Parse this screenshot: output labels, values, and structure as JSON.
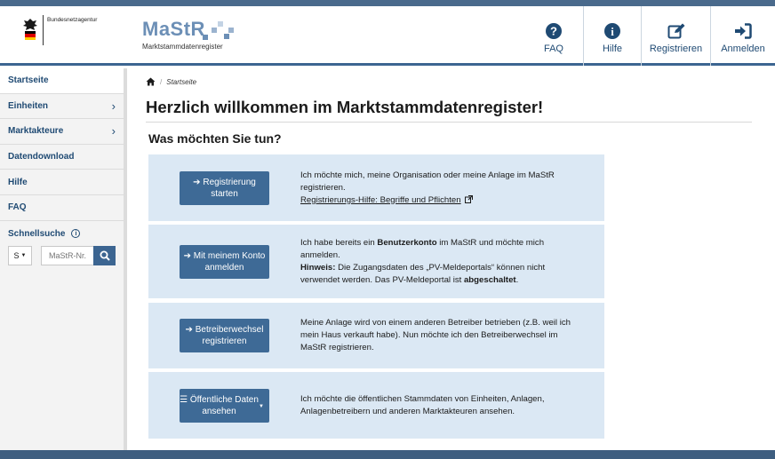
{
  "header": {
    "agency": "Bundesnetzagentur",
    "logo_word": "MaStR",
    "logo_sub": "Marktstammdatenregister",
    "nav": [
      {
        "label": "FAQ",
        "icon": "question-circle-icon"
      },
      {
        "label": "Hilfe",
        "icon": "info-circle-icon"
      },
      {
        "label": "Registrieren",
        "icon": "edit-icon"
      },
      {
        "label": "Anmelden",
        "icon": "sign-in-icon"
      }
    ]
  },
  "sidebar": {
    "items": [
      {
        "label": "Startseite",
        "chevron": ""
      },
      {
        "label": "Einheiten",
        "chevron": "›"
      },
      {
        "label": "Marktakteure",
        "chevron": "›"
      },
      {
        "label": "Datendownload",
        "chevron": ""
      },
      {
        "label": "Hilfe",
        "chevron": ""
      },
      {
        "label": "FAQ",
        "chevron": ""
      }
    ],
    "quicksearch": {
      "title": "Schnellsuche",
      "select_value": "S",
      "placeholder": "MaStR-Nr."
    }
  },
  "main": {
    "breadcrumb": "Startseite",
    "title": "Herzlich willkommen im Marktstammdatenregister!",
    "subtitle": "Was möchten Sie tun?",
    "cards": [
      {
        "button": "Registrierung starten",
        "text1": "Ich möchte mich, meine Organisation oder meine Anlage im MaStR registrieren.",
        "link": "Registrierungs-Hilfe: Begriffe und Pflichten"
      },
      {
        "button": "Mit meinem Konto anmelden",
        "pre": "Ich habe bereits ein ",
        "bold1": "Benutzerkonto",
        "post": " im MaStR und möchte mich anmelden.",
        "hint_label": "Hinweis:",
        "hint_text": " Die Zugangsdaten des „PV-Meldeportals“ können nicht verwendet werden. Das PV-Meldeportal ist ",
        "hint_bold": "abgeschaltet",
        "hint_end": "."
      },
      {
        "button": "Betreiberwechsel registrieren",
        "text1": "Meine Anlage wird von einem anderen Betreiber betrieben (z.B. weil ich mein Haus verkauft habe). Nun möchte ich den Betreiberwechsel im MaStR registrieren."
      },
      {
        "button": "Öffentliche Daten ansehen",
        "text1": "Ich möchte die öffentlichen Stammdaten von Einheiten, Anlagen, Anlagenbetreibern und anderen Marktakteuren ansehen."
      }
    ]
  },
  "colors": {
    "primary": "#3e6a96",
    "nav_text": "#1f4a73",
    "card_bg": "#dbe8f4",
    "topbar": "#4a6a8c"
  }
}
